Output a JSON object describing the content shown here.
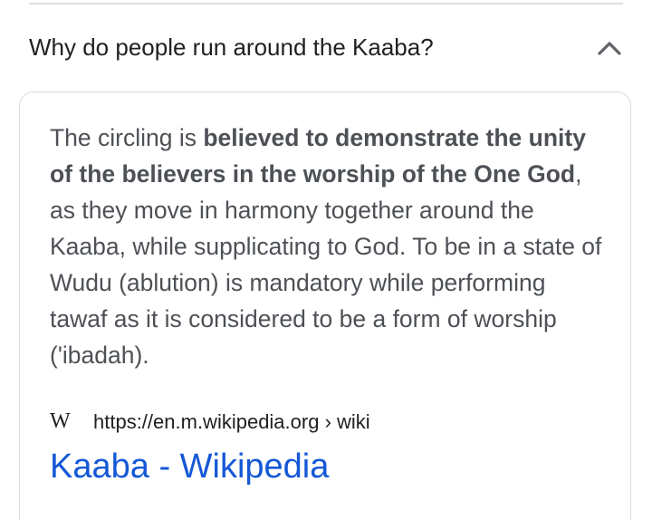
{
  "faq": {
    "question": "Why do people run around the Kaaba?",
    "toggle_icon": "chevron-up-icon"
  },
  "answer": {
    "text_before": "The circling is ",
    "text_bold": "believed to demonstrate the unity of the believers in the worship of the One God",
    "text_after": ", as they move in harmony together around the Kaaba, while supplicating to God. To be in a state of Wudu (ablution) is mandatory while performing tawaf as it is considered to be a form of worship ('ibadah)."
  },
  "source": {
    "logo_text": "W",
    "url": "https://en.m.wikipedia.org › wiki",
    "title": "Kaaba - Wikipedia"
  },
  "colors": {
    "link": "#1558d6",
    "text": "#4d5156",
    "border": "#dadce0"
  }
}
